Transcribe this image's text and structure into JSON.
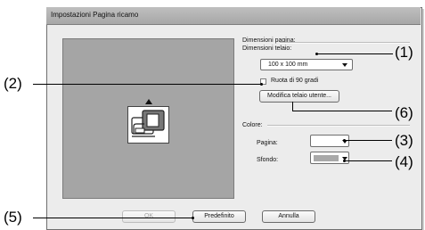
{
  "dialog": {
    "title": "Impostazioni Pagina ricamo"
  },
  "page_size": {
    "section_label": "Dimensioni pagina:",
    "frame_label": "Dimensioni telaio:",
    "frame_value": "100 x 100 mm",
    "rotate_label": "Ruota di 90 gradi",
    "rotate_checked": false,
    "modify_button": "Modifica telaio utente..."
  },
  "color": {
    "section_label": "Colore:",
    "page_label": "Pagina:",
    "page_color": "#ffffff",
    "background_label": "Sfondo:",
    "background_color": "#a9a9a9"
  },
  "buttons": {
    "ok": "OK",
    "default": "Predefinito",
    "cancel": "Annulla"
  },
  "callouts": {
    "c1": "(1)",
    "c2": "(2)",
    "c3": "(3)",
    "c4": "(4)",
    "c5": "(5)",
    "c6": "(6)"
  },
  "preview": {
    "icon": "embroidery-machine-icon"
  }
}
